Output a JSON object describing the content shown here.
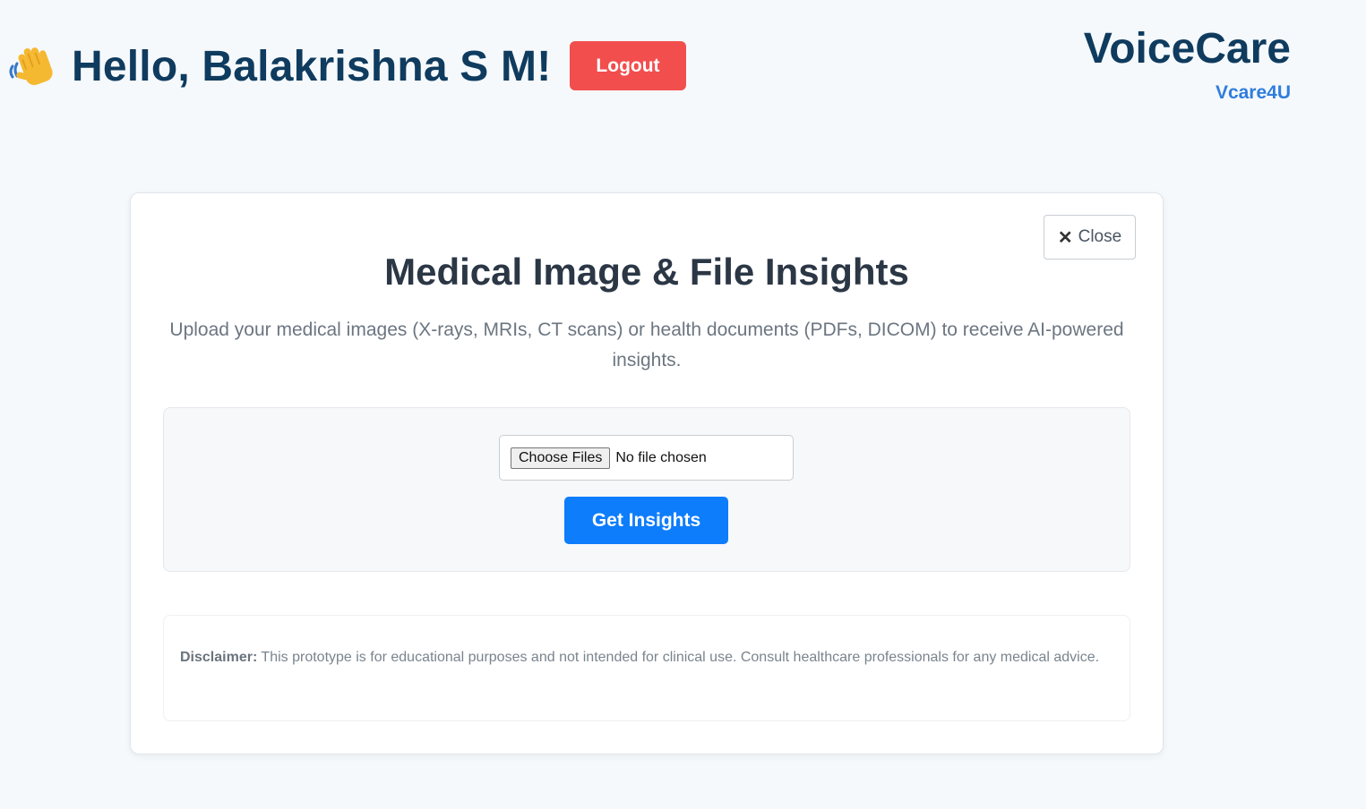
{
  "header": {
    "greeting": "Hello, Balakrishna S M!",
    "wave_icon": "waving-hand",
    "logout_label": "Logout"
  },
  "brand": {
    "name": "VoiceCare",
    "tagline": "Vcare4U"
  },
  "modal": {
    "close_icon": "✕",
    "close_label": "Close",
    "title": "Medical Image & File Insights",
    "description": "Upload your medical images (X-rays, MRIs, CT scans) or health documents (PDFs, DICOM) to receive AI-powered insights.",
    "file_input": {
      "button_label": "Choose Files",
      "status": "No file chosen"
    },
    "submit_label": "Get Insights",
    "disclaimer": {
      "label": "Disclaimer:",
      "text": "This prototype is for educational purposes and not intended for clinical use. Consult healthcare professionals for any medical advice."
    }
  },
  "colors": {
    "background": "#f5f9fc",
    "heading": "#0f3b5e",
    "brand_tag": "#2f7dde",
    "logout": "#f24e4e",
    "primary_button": "#0d7dfc"
  }
}
